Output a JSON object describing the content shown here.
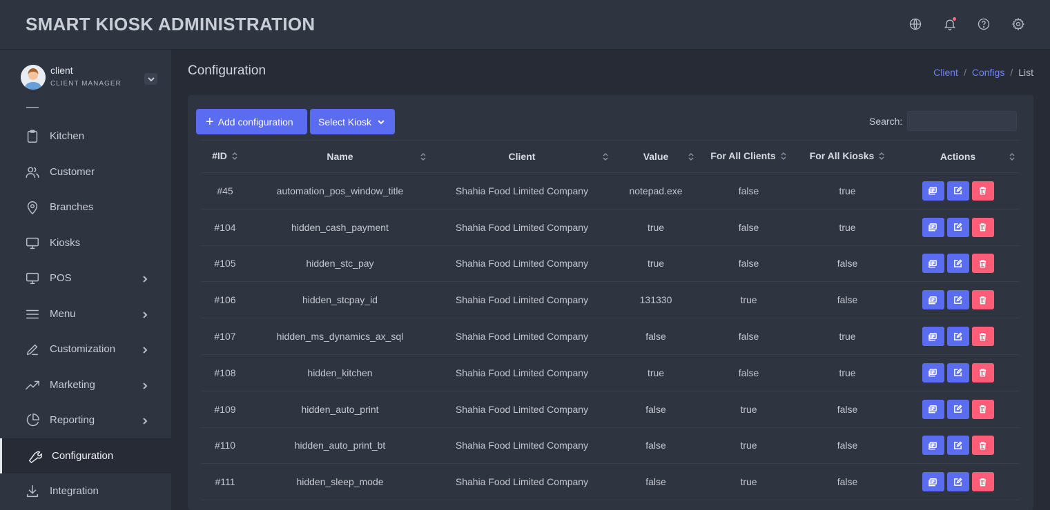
{
  "header": {
    "title": "SMART KIOSK ADMINISTRATION",
    "icons": [
      "globe-icon",
      "bell-icon",
      "help-icon",
      "gear-icon"
    ]
  },
  "user": {
    "name": "client",
    "role": "CLIENT MANAGER"
  },
  "sidebar": {
    "items": [
      {
        "label": "Kitchen",
        "icon": "clipboard-icon",
        "has_children": false,
        "active": false
      },
      {
        "label": "Customer",
        "icon": "users-icon",
        "has_children": false,
        "active": false
      },
      {
        "label": "Branches",
        "icon": "map-pin-icon",
        "has_children": false,
        "active": false
      },
      {
        "label": "Kiosks",
        "icon": "monitor-icon",
        "has_children": false,
        "active": false
      },
      {
        "label": "POS",
        "icon": "monitor-icon",
        "has_children": true,
        "active": false
      },
      {
        "label": "Menu",
        "icon": "menu-icon",
        "has_children": true,
        "active": false
      },
      {
        "label": "Customization",
        "icon": "pen-icon",
        "has_children": true,
        "active": false
      },
      {
        "label": "Marketing",
        "icon": "trending-up-icon",
        "has_children": true,
        "active": false
      },
      {
        "label": "Reporting",
        "icon": "pie-chart-icon",
        "has_children": true,
        "active": false
      },
      {
        "label": "Configuration",
        "icon": "wrench-icon",
        "has_children": false,
        "active": true
      },
      {
        "label": "Integration",
        "icon": "download-icon",
        "has_children": false,
        "active": false
      }
    ]
  },
  "page": {
    "title": "Configuration",
    "breadcrumb": [
      {
        "label": "Client",
        "link": true
      },
      {
        "label": "Configs",
        "link": true
      },
      {
        "label": "List",
        "link": false
      }
    ]
  },
  "toolbar": {
    "add_label": "Add configuration",
    "kiosk_label": "Select Kiosk",
    "search_label": "Search:",
    "search_value": ""
  },
  "table": {
    "columns": [
      "#ID",
      "Name",
      "Client",
      "Value",
      "For All Clients",
      "For All Kiosks",
      "Actions"
    ],
    "rows": [
      {
        "id": "#45",
        "name": "automation_pos_window_title",
        "client": "Shahia Food Limited Company",
        "value": "notepad.exe",
        "all_clients": "false",
        "all_kiosks": "true"
      },
      {
        "id": "#104",
        "name": "hidden_cash_payment",
        "client": "Shahia Food Limited Company",
        "value": "true",
        "all_clients": "false",
        "all_kiosks": "true"
      },
      {
        "id": "#105",
        "name": "hidden_stc_pay",
        "client": "Shahia Food Limited Company",
        "value": "true",
        "all_clients": "false",
        "all_kiosks": "false"
      },
      {
        "id": "#106",
        "name": "hidden_stcpay_id",
        "client": "Shahia Food Limited Company",
        "value": "131330",
        "all_clients": "true",
        "all_kiosks": "false"
      },
      {
        "id": "#107",
        "name": "hidden_ms_dynamics_ax_sql",
        "client": "Shahia Food Limited Company",
        "value": "false",
        "all_clients": "false",
        "all_kiosks": "true"
      },
      {
        "id": "#108",
        "name": "hidden_kitchen",
        "client": "Shahia Food Limited Company",
        "value": "true",
        "all_clients": "false",
        "all_kiosks": "true"
      },
      {
        "id": "#109",
        "name": "hidden_auto_print",
        "client": "Shahia Food Limited Company",
        "value": "false",
        "all_clients": "true",
        "all_kiosks": "false"
      },
      {
        "id": "#110",
        "name": "hidden_auto_print_bt",
        "client": "Shahia Food Limited Company",
        "value": "false",
        "all_clients": "true",
        "all_kiosks": "false"
      },
      {
        "id": "#111",
        "name": "hidden_sleep_mode",
        "client": "Shahia Food Limited Company",
        "value": "false",
        "all_clients": "true",
        "all_kiosks": "false"
      }
    ]
  },
  "colors": {
    "accent": "#5a6cf0",
    "danger": "#ff5c78",
    "link": "#6f82ff"
  }
}
